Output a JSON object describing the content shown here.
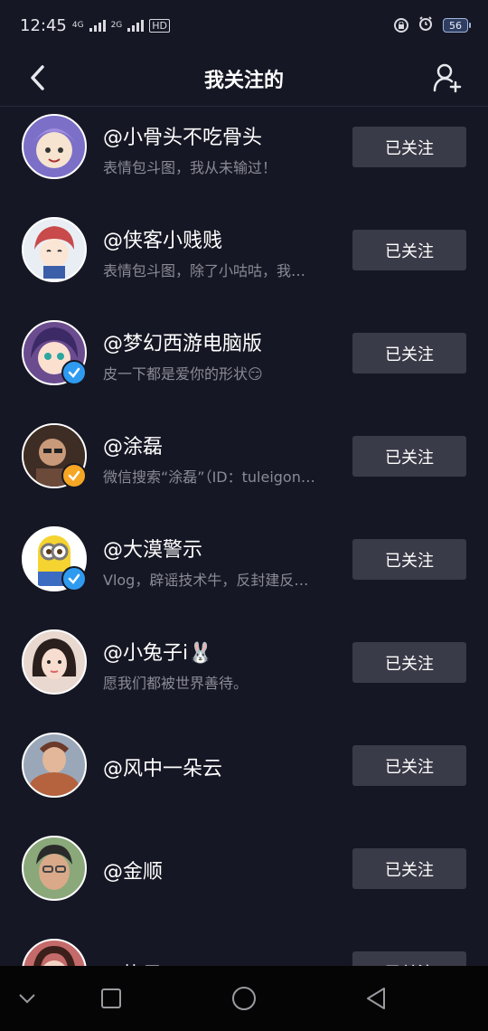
{
  "status_bar": {
    "time": "12:45",
    "net1": "4G",
    "net2": "2G",
    "hd": "HD",
    "battery": "56"
  },
  "header": {
    "title": "我关注的"
  },
  "icons": {
    "back": "back-arrow-icon",
    "add_friend": "add-user-icon"
  },
  "following": [
    {
      "name": "@小骨头不吃骨头",
      "desc": "表情包斗图，我从未输过！",
      "button": "已关注",
      "verified": "",
      "avatar_color": "#7b6fc8"
    },
    {
      "name": "@侠客小贱贱",
      "desc": "表情包斗图，除了小咕咕，我…",
      "button": "已关注",
      "verified": "",
      "avatar_color": "#c94a4a"
    },
    {
      "name": "@梦幻西游电脑版",
      "desc": "皮一下都是爱你的形状😏",
      "button": "已关注",
      "verified": "blue",
      "avatar_color": "#6a4c8f"
    },
    {
      "name": "@涂磊",
      "desc": "微信搜索“涂磊”（ID：tuleigon…",
      "button": "已关注",
      "verified": "orange",
      "avatar_color": "#5a4235"
    },
    {
      "name": "@大漠警示",
      "desc": "Vlog，辟谣技术牛，反封建反…",
      "button": "已关注",
      "verified": "blue",
      "avatar_color": "#f2d23c"
    },
    {
      "name": "@小兔子i🐰",
      "desc": "愿我们都被世界善待。",
      "button": "已关注",
      "verified": "",
      "avatar_color": "#d9b8a8"
    },
    {
      "name": "@风中一朵云",
      "desc": "",
      "button": "已关注",
      "verified": "",
      "avatar_color": "#b5633e"
    },
    {
      "name": "@金顺",
      "desc": "",
      "button": "已关注",
      "verified": "",
      "avatar_color": "#8aa87a"
    },
    {
      "name": "@执予",
      "desc": "",
      "button": "已关注",
      "verified": "",
      "avatar_color": "#c46a6a"
    }
  ],
  "colors": {
    "background": "#161724",
    "button_bg": "#3a3b48",
    "verified_blue": "#2f9bf0",
    "verified_orange": "#f5a623"
  },
  "system_nav": [
    "chevron-down-icon",
    "square-icon",
    "circle-icon",
    "triangle-back-icon"
  ]
}
